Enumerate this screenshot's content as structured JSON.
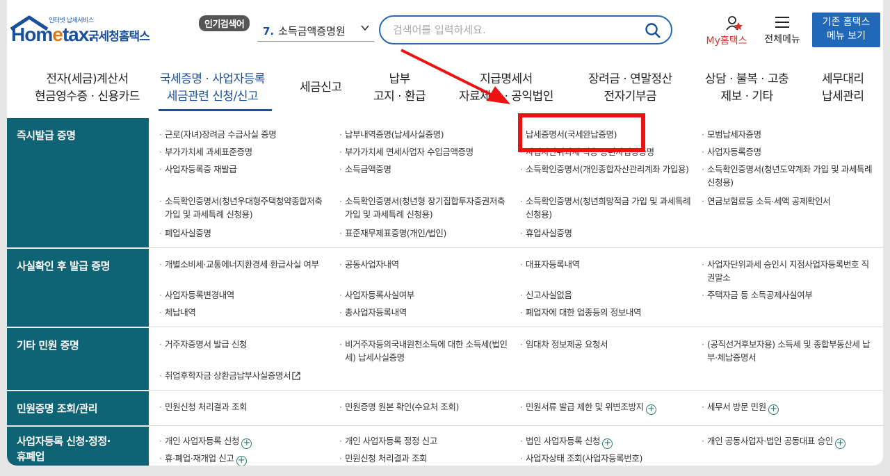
{
  "header": {
    "logo_tagline": "인터넷 납세서비스",
    "logo_text_ho": "Hom",
    "logo_text_e": "e",
    "logo_text_tax": "tax.",
    "logo_org": "국세청홈택스",
    "popular_badge": "인기검색어",
    "popular_num": "7.",
    "popular_term": "소득금액증명원",
    "search_placeholder": "검색어를 입력하세요.",
    "my_label": "My홈택스",
    "menu_label": "전체메뉴",
    "old_menu_line1": "기존 홈택스",
    "old_menu_line2": "메뉴 보기"
  },
  "gnb": [
    {
      "l1": "전자(세금)계산서",
      "l2": "현금영수증 · 신용카드"
    },
    {
      "l1": "국세증명 · 사업자등록",
      "l2": "세금관련 신청/신고"
    },
    {
      "l1": "세금신고",
      "l2": ""
    },
    {
      "l1": "납부",
      "l2": "고지 · 환급"
    },
    {
      "l1": "지급명세서",
      "l2": "자료제출 · 공익법인"
    },
    {
      "l1": "장려금 · 연말정산",
      "l2": "전자기부금"
    },
    {
      "l1": "상담 · 불복 · 고충",
      "l2": "제보 · 기타"
    },
    {
      "l1": "세무대리",
      "l2": "납세관리"
    }
  ],
  "sections": [
    {
      "title": "즉시발급 증명",
      "items": [
        "근로(자녀)장려금 수급사실 증명",
        "납부내역증명(납세사실증명)",
        "납세증명서(국세완납증명)",
        "모범납세자증명",
        "부가가치세 과세표준증명",
        "부가가치세 면세사업자 수입금액증명",
        "사업자단위과세 적용 종된사업장증명",
        "사업자등록증명",
        "사업자등록증 재발급",
        "소득금액증명",
        "소득확인증명서(개인종합자산관리계좌 가입용)",
        "소득확인증명서(청년도약계좌 가입 및 과세특례 신청용)",
        "소득확인증명서(청년우대형주택청약종합저축 가입 및 과세특례 신청용)",
        "소득확인증명서(청년형 장기집합투자증권저축 가입 및 과세특례 신청용)",
        "소득확인증명서(청년희망적금 가입 및 과세특례 신청용)",
        "연금보험료등 소득·세액 공제확인서",
        "폐업사실증명",
        "표준재무제표증명(개인/법인)",
        "휴업사실증명"
      ]
    },
    {
      "title": "사실확인 후 발급 증명",
      "items": [
        "개별소비세·교통에너지환경세 환급사실 여부",
        "공동사업자내역",
        "대표자등록내역",
        "사업자단위과세 승인시 지점사업자등록번호 직권말소",
        "사업자등록변경내역",
        "사업자등록사실여부",
        "신고사실없음",
        "주택자금 등 소득공제사실여부",
        "체납내역",
        "총사업자등록내역",
        "폐업자에 대한 업종등의 정보내역"
      ]
    },
    {
      "title": "기타 민원 증명",
      "items": [
        "거주자증명서 발급 신청",
        "비거주자등의국내원천소득에 대한 소득세(법인세) 납세사실증명",
        "임대차 정보제공 요청서",
        "(공직선거후보자용) 소득세 및 종합부동산세 납부·체납증명서",
        "취업후학자금 상환금납부사실증명서"
      ]
    },
    {
      "title": "민원증명 조회/관리",
      "items": [
        "민원신청 처리결과 조회",
        "민원증명 원본 확인(수요처 조회)",
        "민원서류 발급 제한 및 위변조방지",
        "세무서 방문 민원"
      ]
    },
    {
      "title_l1": "사업자등록 신청·정정·",
      "title_l2": "휴폐업",
      "items": [
        "개인 사업자등록 신청",
        "개인 사업자등록 정정 신고",
        "법인 사업자등록 신청",
        "개인 공동사업자·법인 공동대표 승인",
        "휴·폐업·재개업 신고",
        "민원신청 처리결과 조회",
        "사업자상태 조회(사업자등록번호)"
      ]
    }
  ],
  "colors": {
    "brand_blue": "#1a4f9c",
    "sidebar_teal": "#0e6375",
    "annotation_red": "#ee1111",
    "my_red": "#d4322b"
  },
  "icons": [
    "search-icon",
    "my-user-icon",
    "hamburger-icon",
    "chevron-down-icon",
    "plus-circle-icon",
    "external-link-icon",
    "house-roof-icon"
  ]
}
